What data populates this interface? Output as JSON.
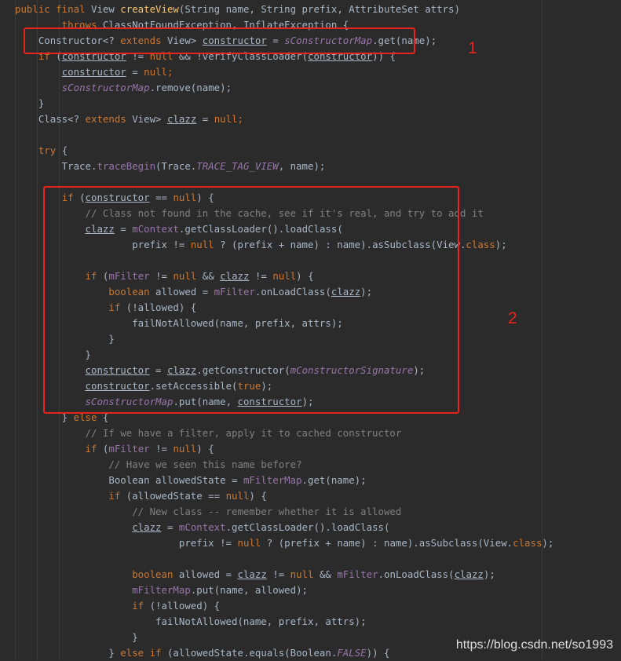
{
  "colors": {
    "background": "#2b2b2b",
    "text": "#a9b7c6",
    "keyword": "#cc7832",
    "method_decl": "#ffc66d",
    "field": "#9876aa",
    "comment": "#808080",
    "annotation_red": "#e8241c"
  },
  "annotations": [
    {
      "label": "1"
    },
    {
      "label": "2"
    }
  ],
  "watermark": "https://blog.csdn.net/so1993",
  "code_lines": [
    [
      [
        "public final ",
        "kw"
      ],
      [
        "View ",
        "plain"
      ],
      [
        "createView",
        "fn"
      ],
      [
        "(String name, String prefix, AttributeSet attrs)",
        "plain"
      ]
    ],
    [
      [
        "        throws ",
        "kw"
      ],
      [
        "ClassNotFoundException, InflateException {",
        "plain"
      ]
    ],
    [
      [
        "    Constructor<? ",
        "plain"
      ],
      [
        "extends ",
        "kw"
      ],
      [
        "View> ",
        "plain"
      ],
      [
        "constructor",
        "ul"
      ],
      [
        " = ",
        "plain"
      ],
      [
        "sConstructorMap",
        "sfld"
      ],
      [
        ".get(name);",
        "plain"
      ]
    ],
    [
      [
        "    ",
        "plain"
      ],
      [
        "if ",
        "kw"
      ],
      [
        "(",
        "plain"
      ],
      [
        "constructor",
        "ul"
      ],
      [
        " != ",
        "plain"
      ],
      [
        "null ",
        "kw"
      ],
      [
        "&& !verifyClassLoader(",
        "plain"
      ],
      [
        "constructor",
        "ul"
      ],
      [
        ")) {",
        "plain"
      ]
    ],
    [
      [
        "        ",
        "plain"
      ],
      [
        "constructor",
        "ul"
      ],
      [
        " = ",
        "plain"
      ],
      [
        "null",
        "kw"
      ],
      [
        ";",
        "kw"
      ]
    ],
    [
      [
        "        ",
        "plain"
      ],
      [
        "sConstructorMap",
        "sfld"
      ],
      [
        ".remove(name);",
        "plain"
      ]
    ],
    [
      [
        "    }",
        "plain"
      ]
    ],
    [
      [
        "    Class<? ",
        "plain"
      ],
      [
        "extends ",
        "kw"
      ],
      [
        "View> ",
        "plain"
      ],
      [
        "clazz",
        "ul"
      ],
      [
        " = ",
        "plain"
      ],
      [
        "null",
        "kw"
      ],
      [
        ";",
        "kw"
      ]
    ],
    [
      [
        "",
        "plain"
      ]
    ],
    [
      [
        "    ",
        "plain"
      ],
      [
        "try ",
        "kw"
      ],
      [
        "{",
        "plain"
      ]
    ],
    [
      [
        "        Trace.",
        "plain"
      ],
      [
        "traceBegin",
        "fld"
      ],
      [
        "(Trace.",
        "plain"
      ],
      [
        "TRACE_TAG_VIEW",
        "cst"
      ],
      [
        ", name);",
        "plain"
      ]
    ],
    [
      [
        "",
        "plain"
      ]
    ],
    [
      [
        "        ",
        "plain"
      ],
      [
        "if ",
        "kw"
      ],
      [
        "(",
        "plain"
      ],
      [
        "constructor",
        "ul"
      ],
      [
        " == ",
        "plain"
      ],
      [
        "null",
        "kw"
      ],
      [
        ") {",
        "plain"
      ]
    ],
    [
      [
        "            // Class not found in the cache, see if it's real, and try to add it",
        "cm"
      ]
    ],
    [
      [
        "            ",
        "plain"
      ],
      [
        "clazz",
        "ul"
      ],
      [
        " = ",
        "plain"
      ],
      [
        "mContext",
        "fld"
      ],
      [
        ".getClassLoader().loadClass(",
        "plain"
      ]
    ],
    [
      [
        "                    prefix != ",
        "plain"
      ],
      [
        "null ",
        "kw"
      ],
      [
        "? (prefix + name) : name).asSubclass(View.",
        "plain"
      ],
      [
        "class",
        "kw"
      ],
      [
        ");",
        "plain"
      ]
    ],
    [
      [
        "",
        "plain"
      ]
    ],
    [
      [
        "            ",
        "plain"
      ],
      [
        "if ",
        "kw"
      ],
      [
        "(",
        "plain"
      ],
      [
        "mFilter",
        "fld"
      ],
      [
        " != ",
        "plain"
      ],
      [
        "null ",
        "kw"
      ],
      [
        "&& ",
        "plain"
      ],
      [
        "clazz",
        "ul"
      ],
      [
        " != ",
        "plain"
      ],
      [
        "null",
        "kw"
      ],
      [
        ") {",
        "plain"
      ]
    ],
    [
      [
        "                ",
        "plain"
      ],
      [
        "boolean ",
        "kw"
      ],
      [
        "allowed = ",
        "plain"
      ],
      [
        "mFilter",
        "fld"
      ],
      [
        ".onLoadClass(",
        "plain"
      ],
      [
        "clazz",
        "ul"
      ],
      [
        ");",
        "plain"
      ]
    ],
    [
      [
        "                ",
        "plain"
      ],
      [
        "if ",
        "kw"
      ],
      [
        "(!allowed) {",
        "plain"
      ]
    ],
    [
      [
        "                    failNotAllowed(name, prefix, attrs);",
        "plain"
      ]
    ],
    [
      [
        "                }",
        "plain"
      ]
    ],
    [
      [
        "            }",
        "plain"
      ]
    ],
    [
      [
        "            ",
        "plain"
      ],
      [
        "constructor",
        "ul"
      ],
      [
        " = ",
        "plain"
      ],
      [
        "clazz",
        "ul"
      ],
      [
        ".getConstructor(",
        "plain"
      ],
      [
        "mConstructorSignature",
        "sfld"
      ],
      [
        ");",
        "plain"
      ]
    ],
    [
      [
        "            ",
        "plain"
      ],
      [
        "constructor",
        "ul"
      ],
      [
        ".setAccessible(",
        "plain"
      ],
      [
        "true",
        "kw"
      ],
      [
        ");",
        "plain"
      ]
    ],
    [
      [
        "            ",
        "plain"
      ],
      [
        "sConstructorMap",
        "sfld"
      ],
      [
        ".put(name, ",
        "plain"
      ],
      [
        "constructor",
        "ul"
      ],
      [
        ");",
        "plain"
      ]
    ],
    [
      [
        "        } ",
        "plain"
      ],
      [
        "else ",
        "kw"
      ],
      [
        "{",
        "plain"
      ]
    ],
    [
      [
        "            // If we have a filter, apply it to cached constructor",
        "cm"
      ]
    ],
    [
      [
        "            ",
        "plain"
      ],
      [
        "if ",
        "kw"
      ],
      [
        "(",
        "plain"
      ],
      [
        "mFilter",
        "fld"
      ],
      [
        " != ",
        "plain"
      ],
      [
        "null",
        "kw"
      ],
      [
        ") {",
        "plain"
      ]
    ],
    [
      [
        "                // Have we seen this name before?",
        "cm"
      ]
    ],
    [
      [
        "                Boolean allowedState = ",
        "plain"
      ],
      [
        "mFilterMap",
        "fld"
      ],
      [
        ".get(name);",
        "plain"
      ]
    ],
    [
      [
        "                ",
        "plain"
      ],
      [
        "if ",
        "kw"
      ],
      [
        "(allowedState == ",
        "plain"
      ],
      [
        "null",
        "kw"
      ],
      [
        ") {",
        "plain"
      ]
    ],
    [
      [
        "                    // New class -- remember whether it is allowed",
        "cm"
      ]
    ],
    [
      [
        "                    ",
        "plain"
      ],
      [
        "clazz",
        "ul"
      ],
      [
        " = ",
        "plain"
      ],
      [
        "mContext",
        "fld"
      ],
      [
        ".getClassLoader().loadClass(",
        "plain"
      ]
    ],
    [
      [
        "                            prefix != ",
        "plain"
      ],
      [
        "null ",
        "kw"
      ],
      [
        "? (prefix + name) : name).asSubclass(View.",
        "plain"
      ],
      [
        "class",
        "kw"
      ],
      [
        ");",
        "plain"
      ]
    ],
    [
      [
        "",
        "plain"
      ]
    ],
    [
      [
        "                    ",
        "plain"
      ],
      [
        "boolean ",
        "kw"
      ],
      [
        "allowed = ",
        "plain"
      ],
      [
        "clazz",
        "ul"
      ],
      [
        " != ",
        "plain"
      ],
      [
        "null ",
        "kw"
      ],
      [
        "&& ",
        "plain"
      ],
      [
        "mFilter",
        "fld"
      ],
      [
        ".onLoadClass(",
        "plain"
      ],
      [
        "clazz",
        "ul"
      ],
      [
        ");",
        "plain"
      ]
    ],
    [
      [
        "                    ",
        "plain"
      ],
      [
        "mFilterMap",
        "fld"
      ],
      [
        ".put(name, allowed);",
        "plain"
      ]
    ],
    [
      [
        "                    ",
        "plain"
      ],
      [
        "if ",
        "kw"
      ],
      [
        "(!allowed) {",
        "plain"
      ]
    ],
    [
      [
        "                        failNotAllowed(name, prefix, attrs);",
        "plain"
      ]
    ],
    [
      [
        "                    }",
        "plain"
      ]
    ],
    [
      [
        "                } ",
        "plain"
      ],
      [
        "else if ",
        "kw"
      ],
      [
        "(allowedState.equals(Boolean.",
        "plain"
      ],
      [
        "FALSE",
        "cst"
      ],
      [
        ")) {",
        "plain"
      ]
    ]
  ]
}
